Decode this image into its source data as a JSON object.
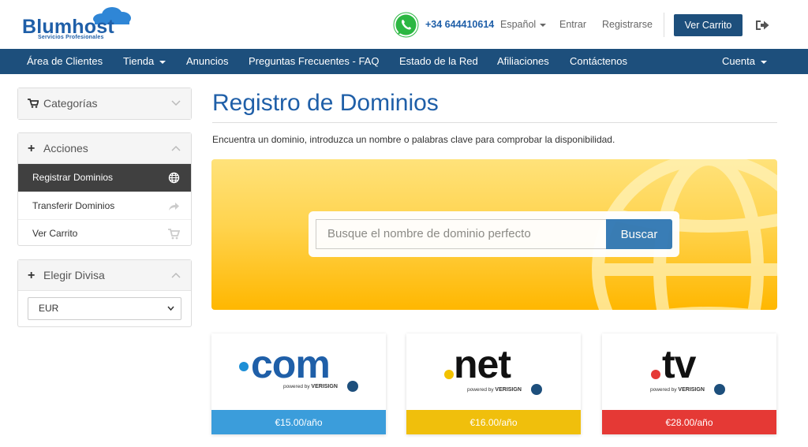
{
  "header": {
    "logo_text": "Blumhost",
    "logo_sub": "Servicios Profesionales",
    "phone": "+34 644410614",
    "language": "Español",
    "login": "Entrar",
    "register": "Registrarse",
    "cart_button": "Ver Carrito"
  },
  "nav": {
    "items": [
      "Área de Clientes",
      "Tienda",
      "Anuncios",
      "Preguntas Frecuentes - FAQ",
      "Estado de la Red",
      "Afiliaciones",
      "Contáctenos"
    ],
    "account": "Cuenta"
  },
  "sidebar": {
    "categories": "Categorías",
    "actions": "Acciones",
    "action_items": [
      "Registrar Dominios",
      "Transferir Dominios",
      "Ver Carrito"
    ],
    "currency_title": "Elegir Divisa",
    "currency_value": "EUR"
  },
  "main": {
    "title": "Registro de Dominios",
    "intro": "Encuentra un dominio, introduzca un nombre o palabras clave para comprobar la disponibilidad.",
    "search_placeholder": "Busque el nombre de dominio perfecto",
    "search_button": "Buscar"
  },
  "tlds": [
    {
      "name": "com",
      "price": "€15.00/año",
      "color": "#3b9ddb",
      "dot": "#1e8fd6"
    },
    {
      "name": "net",
      "price": "€16.00/año",
      "color": "#f0bf0c",
      "dot": "#f2c200"
    },
    {
      "name": "tv",
      "price": "€28.00/año",
      "color": "#e53935",
      "dot": "#e53935"
    }
  ],
  "powered_by": "powered by",
  "verisign": "VERISIGN",
  "colors": {
    "brand": "#1d4f7c",
    "accent": "#337ab7"
  }
}
